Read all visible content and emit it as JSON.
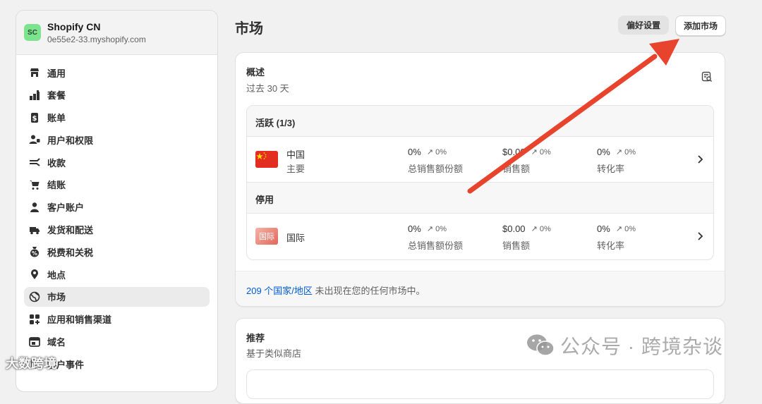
{
  "store": {
    "initials": "SC",
    "name": "Shopify CN",
    "domain": "0e55e2-33.myshopify.com"
  },
  "nav": [
    {
      "label": "通用",
      "icon": "store-icon"
    },
    {
      "label": "套餐",
      "icon": "plan-chart-icon"
    },
    {
      "label": "账单",
      "icon": "billing-icon"
    },
    {
      "label": "用户和权限",
      "icon": "users-icon"
    },
    {
      "label": "收款",
      "icon": "payments-icon"
    },
    {
      "label": "结账",
      "icon": "cart-icon"
    },
    {
      "label": "客户账户",
      "icon": "person-icon"
    },
    {
      "label": "发货和配送",
      "icon": "truck-icon"
    },
    {
      "label": "税费和关税",
      "icon": "tax-bag-icon"
    },
    {
      "label": "地点",
      "icon": "location-pin-icon"
    },
    {
      "label": "市场",
      "icon": "globe-icon",
      "active": true
    },
    {
      "label": "应用和销售渠道",
      "icon": "apps-icon"
    },
    {
      "label": "域名",
      "icon": "domain-icon"
    },
    {
      "label": "客户事件",
      "icon": "cursor-icon"
    }
  ],
  "header": {
    "title": "市场",
    "preferences_label": "偏好设置",
    "add_market_label": "添加市场"
  },
  "overview": {
    "title": "概述",
    "subtitle": "过去 30 天",
    "active_heading": "活跃 (1/3)",
    "inactive_heading": "停用",
    "rows": [
      {
        "flag": "cn-flag",
        "name": "中国",
        "sub": "主要",
        "metrics": [
          {
            "value": "0%",
            "delta": "↗ 0%",
            "label": "总销售额份额"
          },
          {
            "value": "$0.00",
            "delta": "↗ 0%",
            "label": "销售额"
          },
          {
            "value": "0%",
            "delta": "↗ 0%",
            "label": "转化率"
          }
        ]
      },
      {
        "flag": "intl-badge",
        "badge_text": "国际",
        "name": "国际",
        "sub": "",
        "metrics": [
          {
            "value": "0%",
            "delta": "↗ 0%",
            "label": "总销售额份额"
          },
          {
            "value": "$0.00",
            "delta": "↗ 0%",
            "label": "销售额"
          },
          {
            "value": "0%",
            "delta": "↗ 0%",
            "label": "转化率"
          }
        ]
      }
    ],
    "footer_link": "209 个国家/地区",
    "footer_text": " 未出现在您的任何市场中。"
  },
  "recommended": {
    "title": "推荐",
    "subtitle": "基于类似商店"
  },
  "watermarks": {
    "right": "公众号 · 跨境杂谈",
    "left": "大数跨境"
  },
  "colors": {
    "annotation_arrow": "#e8432d",
    "link": "#005bd3",
    "active_nav_bg": "#ebebeb"
  }
}
